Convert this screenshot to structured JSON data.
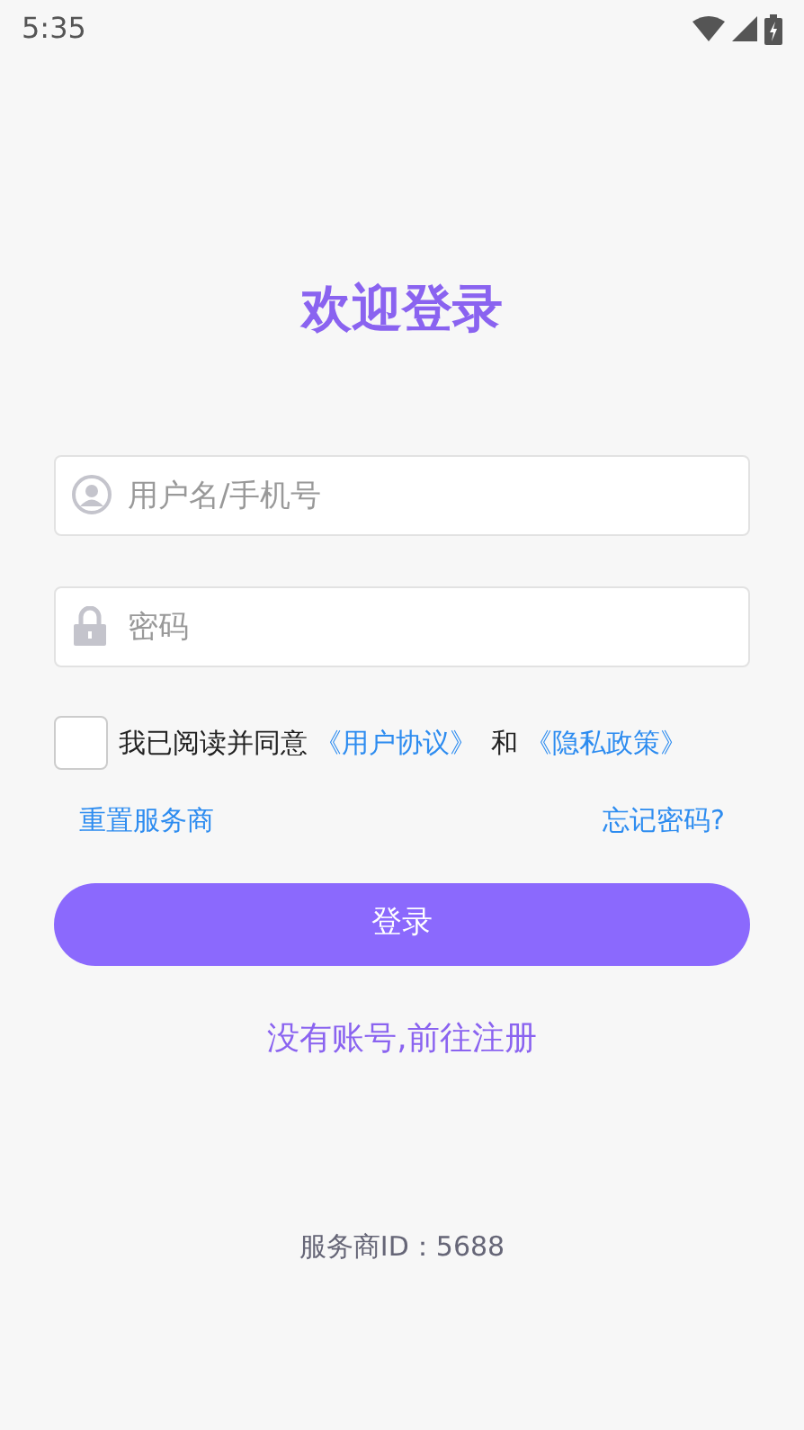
{
  "status_bar": {
    "time": "5:35"
  },
  "title": "欢迎登录",
  "fields": [
    {
      "kind": "user",
      "placeholder": "用户名/手机号"
    },
    {
      "kind": "password",
      "placeholder": "密码"
    }
  ],
  "agreement": {
    "checked": false,
    "parts": [
      {
        "kind": "text",
        "text": "我已阅读并同意"
      },
      {
        "kind": "link",
        "text": "《用户协议》"
      },
      {
        "kind": "text",
        "text": "和"
      },
      {
        "kind": "link",
        "text": "《隐私政策》"
      }
    ]
  },
  "links": [
    "重置服务商",
    "忘记密码?"
  ],
  "login_button": "登录",
  "register_link": "没有账号,前往注册",
  "provider_id": "服务商ID：5688"
}
